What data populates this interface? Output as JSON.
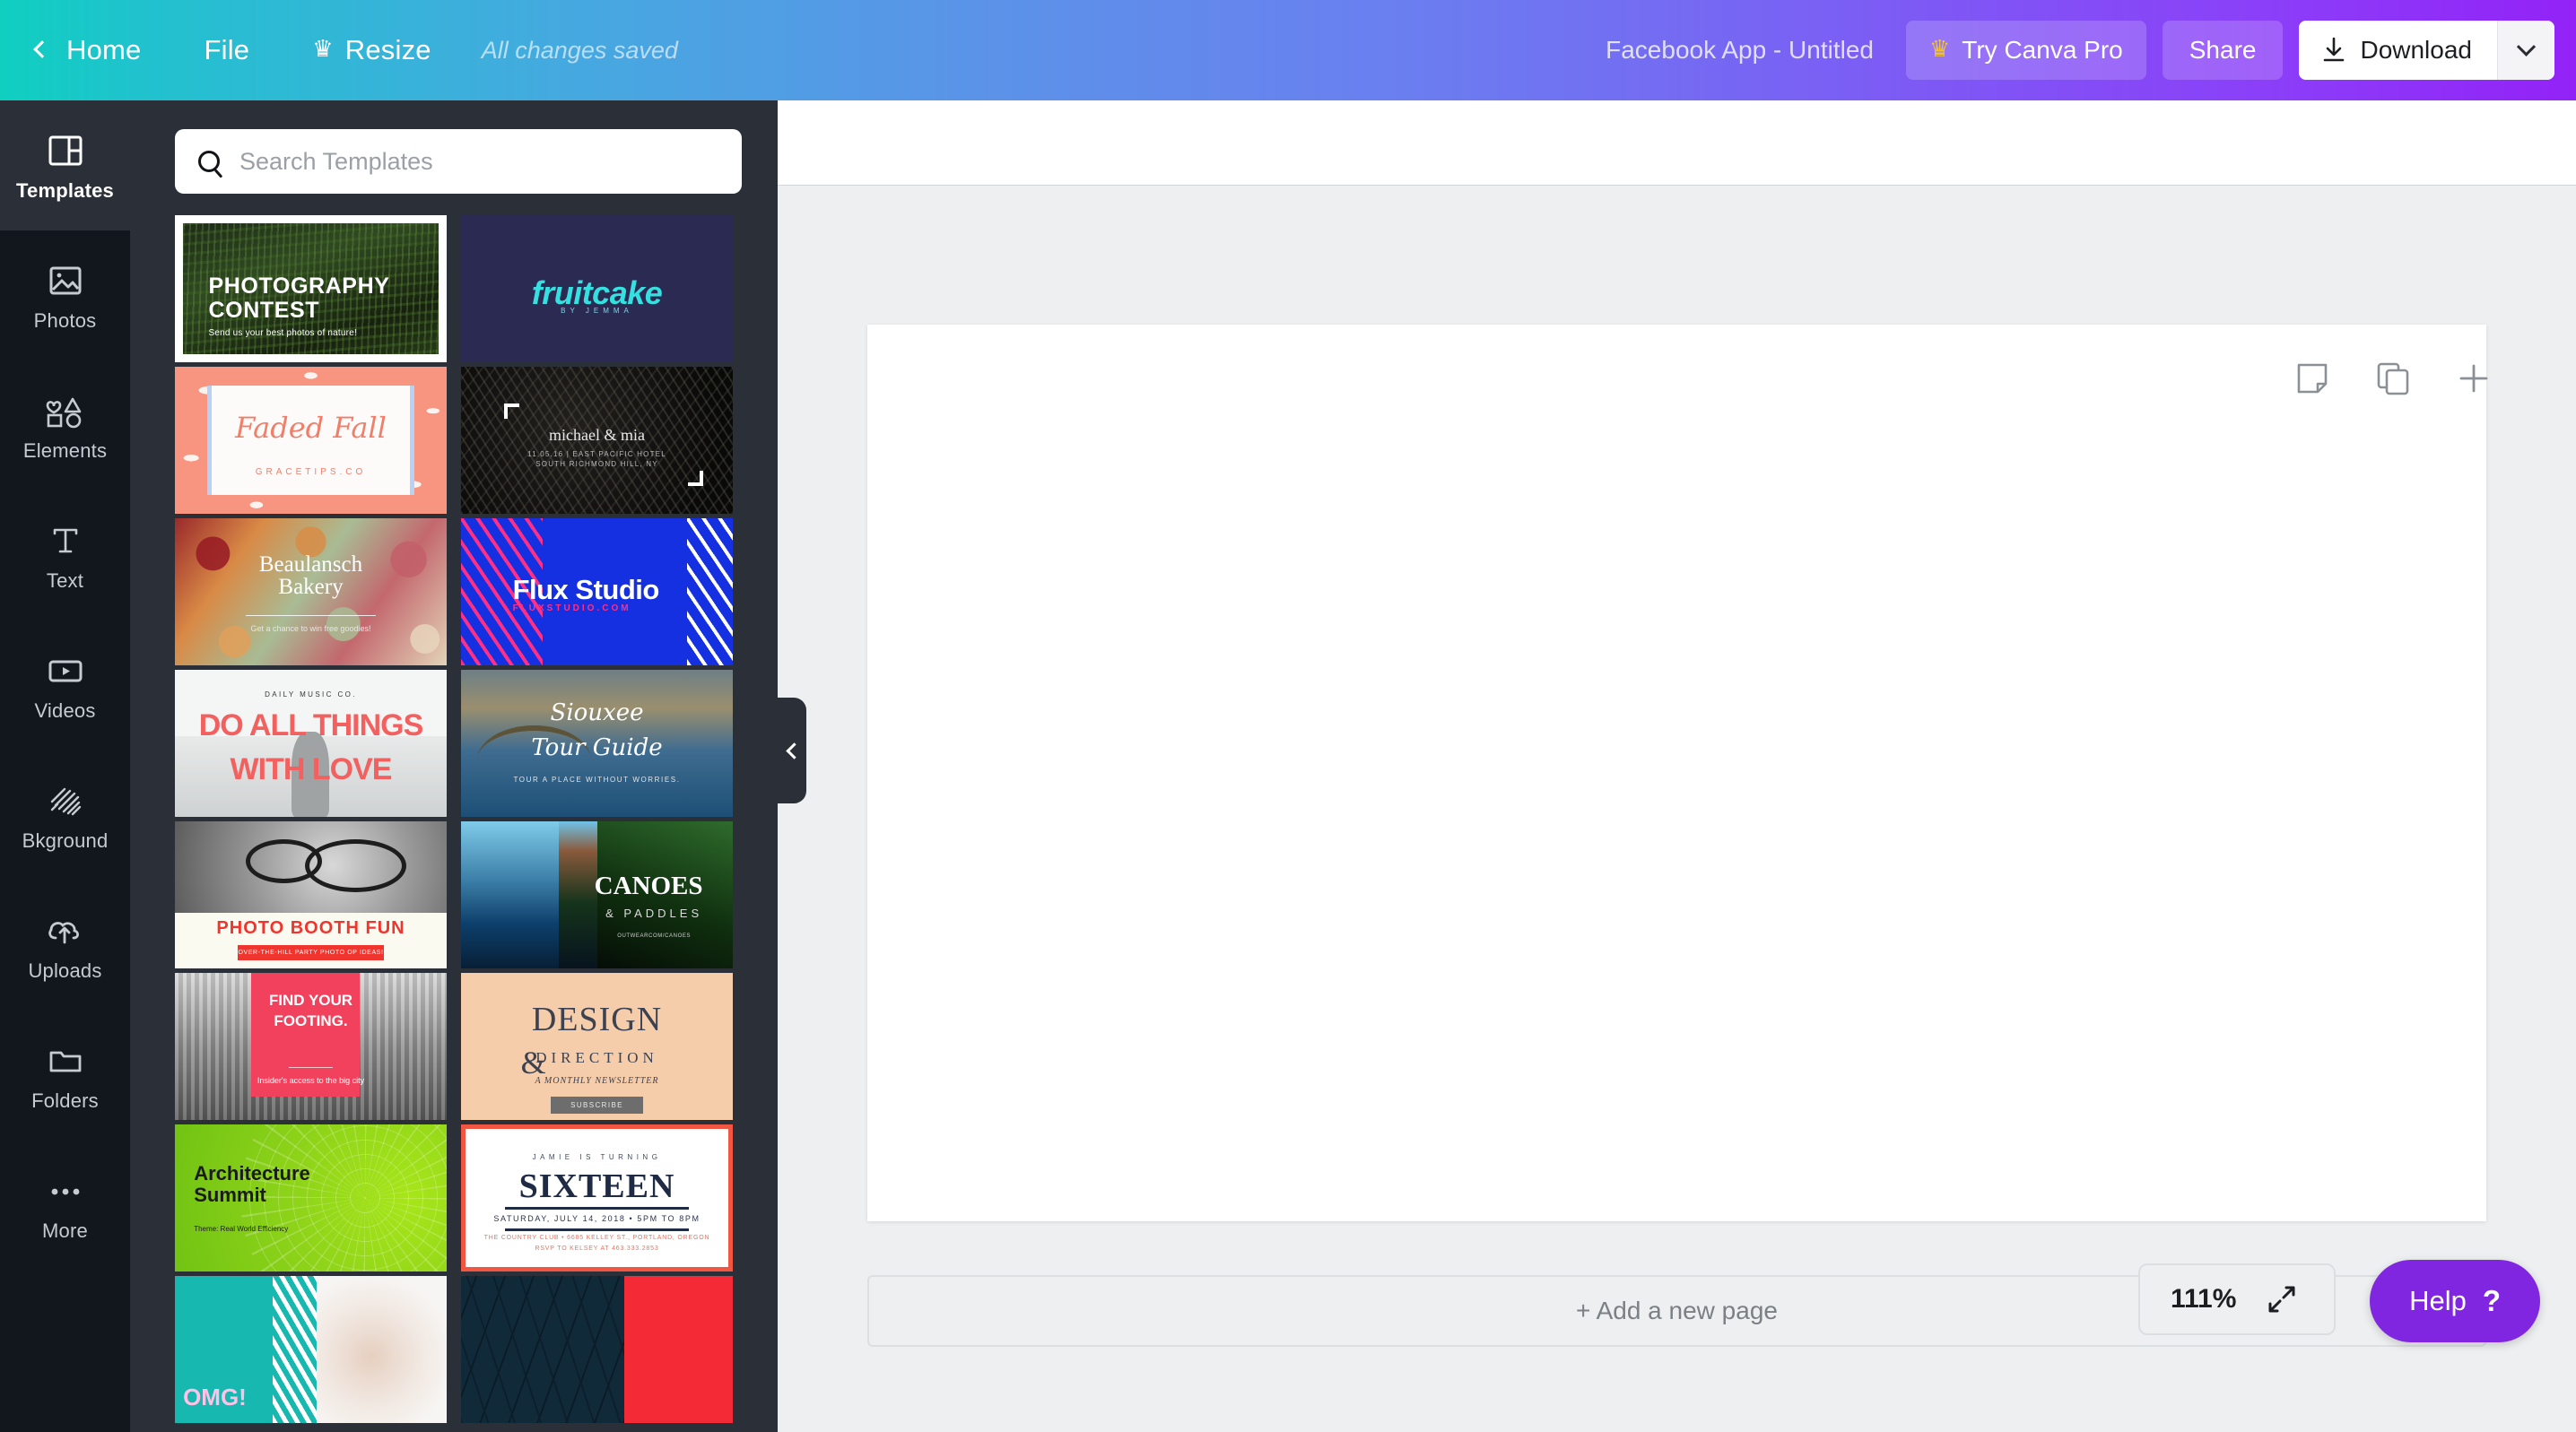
{
  "header": {
    "home_label": "Home",
    "file_label": "File",
    "resize_label": "Resize",
    "resize_icon": "crown-icon",
    "save_status": "All changes saved",
    "doc_title": "Facebook App - Untitled",
    "try_pro_label": "Try Canva Pro",
    "try_pro_icon": "crown-icon",
    "share_label": "Share",
    "download_label": "Download",
    "download_icon": "download-arrow-icon",
    "download_caret_icon": "chevron-down-icon",
    "back_icon": "chevron-left-icon",
    "brand_gradient_start": "#0fcfc0",
    "brand_gradient_end": "#9322f7"
  },
  "rail": {
    "items": [
      {
        "label": "Templates",
        "icon": "templates-icon",
        "active": true
      },
      {
        "label": "Photos",
        "icon": "photo-icon",
        "active": false
      },
      {
        "label": "Elements",
        "icon": "shapes-icon",
        "active": false
      },
      {
        "label": "Text",
        "icon": "text-icon",
        "active": false
      },
      {
        "label": "Videos",
        "icon": "video-icon",
        "active": false
      },
      {
        "label": "Bkground",
        "icon": "hatch-icon",
        "active": false
      },
      {
        "label": "Uploads",
        "icon": "cloud-upload-icon",
        "active": false
      },
      {
        "label": "Folders",
        "icon": "folder-icon",
        "active": false
      },
      {
        "label": "More",
        "icon": "ellipsis-icon",
        "active": false
      }
    ]
  },
  "panel": {
    "search": {
      "placeholder": "Search Templates",
      "value": "",
      "icon": "search-icon"
    },
    "collapse_icon": "chevron-left-icon",
    "templates": [
      [
        {
          "name": "photography-contest",
          "title": "PHOTOGRAPHY",
          "title2": "CONTEST",
          "subtitle": "Send us your best photos of nature!",
          "selected": false
        },
        {
          "name": "fruitcake",
          "title": "fruitcake",
          "subtitle": "BY JEMMA",
          "selected": false
        }
      ],
      [
        {
          "name": "faded-fall",
          "title": "Faded Fall",
          "subtitle": "GRACETIPS.CO",
          "selected": false
        },
        {
          "name": "michael-and-mia",
          "title": "michael & mia",
          "subtitle": "11.05.16 | EAST PACIFIC HOTEL",
          "subtitle2": "SOUTH RICHMOND HILL, NY",
          "selected": false
        }
      ],
      [
        {
          "name": "beaulansch-bakery",
          "title": "Beaulansch",
          "title2": "Bakery",
          "subtitle": "Get a chance to win free goodies!",
          "selected": false
        },
        {
          "name": "flux-studio",
          "title": "Flux Studio",
          "subtitle": "FLUXSTUDIO.COM",
          "selected": false
        }
      ],
      [
        {
          "name": "do-all-things-with-love",
          "eyebrow": "DAILY MUSIC CO.",
          "title": "DO ALL THINGS",
          "title2": "WITH LOVE",
          "selected": false
        },
        {
          "name": "siouxee-tour-guide",
          "title": "Siouxee",
          "title2": "Tour Guide",
          "subtitle": "TOUR A PLACE WITHOUT WORRIES.",
          "selected": false
        }
      ],
      [
        {
          "name": "photo-booth-fun",
          "title": "PHOTO BOOTH FUN",
          "button": "OVER-THE-HILL PARTY PHOTO OP IDEAS!",
          "selected": false
        },
        {
          "name": "canoes-and-paddles",
          "title": "CANOES",
          "subtitle": "& PADDLES",
          "subtitle2": "OUTWEARCOM/CANOES",
          "selected": false
        }
      ],
      [
        {
          "name": "find-your-footing",
          "title": "FIND YOUR FOOTING.",
          "subtitle": "Insider's access to the big city",
          "selected": false
        },
        {
          "name": "design-and-direction",
          "title": "DESIGN",
          "title2": "DIRECTION",
          "amp": "&",
          "subtitle": "A MONTHLY NEWSLETTER",
          "button": "SUBSCRIBE",
          "selected": false
        }
      ],
      [
        {
          "name": "architecture-summit",
          "title": "Architecture",
          "title2": "Summit",
          "subtitle": "Theme: Real World Efficiency",
          "selected": false
        },
        {
          "name": "sixteen-birthday",
          "eyebrow": "JAMIE IS TURNING",
          "title": "SIXTEEN",
          "subtitle": "SATURDAY, JULY 14, 2018 • 5PM TO 8PM",
          "subtitle2": "THE COUNTRY CLUB • 6685 KELLEY ST., PORTLAND, OREGON",
          "subtitle3": "RSVP TO KELSEY AT 463.333.2853",
          "selected": true
        }
      ],
      [
        {
          "name": "omg-beauty",
          "title": "OMG!",
          "selected": false
        },
        {
          "name": "night-lights",
          "title": "",
          "selected": false
        }
      ]
    ],
    "selection_color": "#f15642"
  },
  "canvas": {
    "page_tools": [
      {
        "name": "notes-icon",
        "label": "Notes"
      },
      {
        "name": "duplicate-page-icon",
        "label": "Duplicate page"
      },
      {
        "name": "add-page-icon",
        "label": "Add page"
      }
    ],
    "add_page_label": "+ Add a new page",
    "zoom_value": "111%",
    "zoom_expand_icon": "expand-arrows-icon",
    "help_label": "Help",
    "help_icon": "question-mark-icon",
    "help_color": "#8126e0"
  }
}
